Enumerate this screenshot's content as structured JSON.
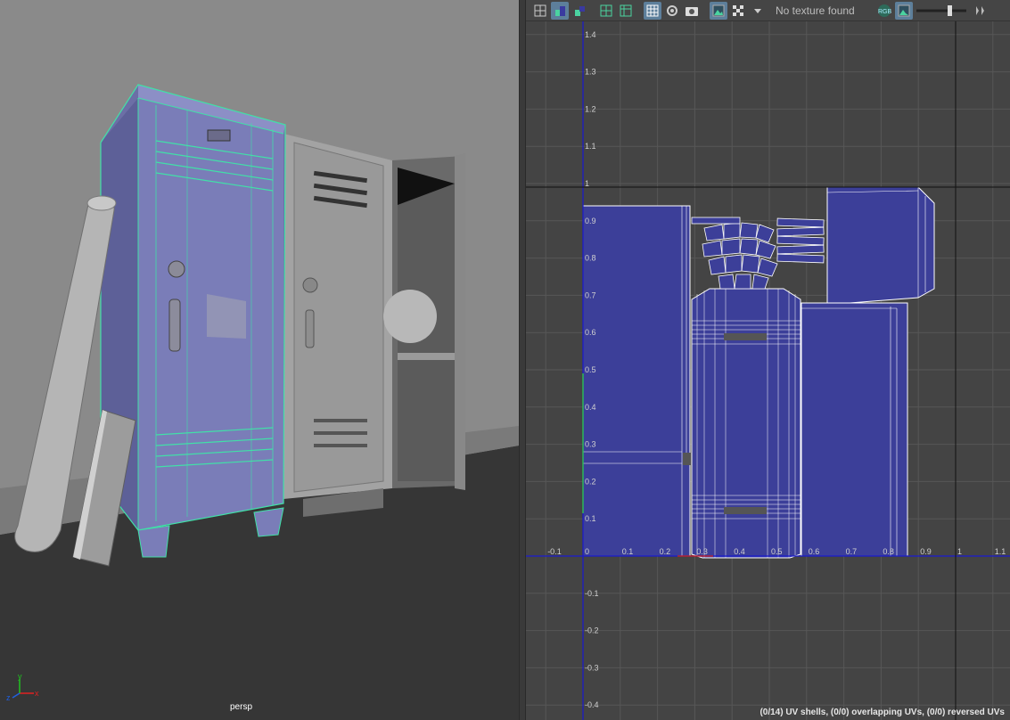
{
  "viewport": {
    "camera_label": "persp",
    "axis_labels": {
      "x": "x",
      "y": "y",
      "z": "z"
    }
  },
  "uv_editor": {
    "toolbar": {
      "texture_status": "No texture found",
      "channel_label": "RGB",
      "icons": [
        "uv-snapshot-icon",
        "isolate-icon",
        "shaded-uv-icon",
        "grid-icon",
        "pixel-snap-icon",
        "checker-grid-icon",
        "display-image-icon",
        "camera-icon",
        "image-icon",
        "checker-icon",
        "dropdown-icon",
        "rgb-channel-icon",
        "alpha-icon",
        "exposure-slider",
        "scroll-arrows-icon"
      ]
    },
    "status_text": "(0/14) UV shells, (0/0) overlapping UVs, (0/0) reversed UVs",
    "axes": {
      "u_ticks": [
        "-0.1",
        "0",
        "0.1",
        "0.2",
        "0.3",
        "0.4",
        "0.5",
        "0.6",
        "0.7",
        "0.8",
        "0.9",
        "1",
        "1.1"
      ],
      "v_ticks": [
        "1.4",
        "1.3",
        "1.2",
        "1.1",
        "1",
        "0.9",
        "0.8",
        "0.7",
        "0.6",
        "0.5",
        "0.4",
        "0.3",
        "0.2",
        "0.1",
        "-0.1",
        "-0.2",
        "-0.3",
        "-0.4"
      ]
    },
    "colors": {
      "uv_fill": "#3c3f99",
      "uv_edge": "#ffffff",
      "grid": "#575757",
      "axis": "#1a1ad0"
    }
  }
}
